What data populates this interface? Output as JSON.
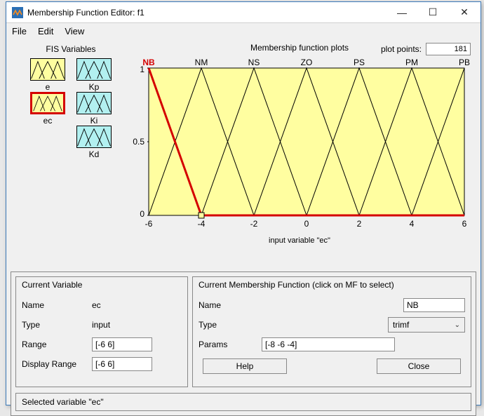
{
  "window": {
    "title": "Membership Function Editor: f1"
  },
  "menu": {
    "file": "File",
    "edit": "Edit",
    "view": "View"
  },
  "fis": {
    "header": "FIS Variables",
    "inputs": [
      {
        "name": "e"
      },
      {
        "name": "ec",
        "selected": true
      }
    ],
    "outputs": [
      {
        "name": "Kp"
      },
      {
        "name": "Ki"
      },
      {
        "name": "Kd"
      }
    ]
  },
  "plot": {
    "title": "Membership function plots",
    "plot_points_label": "plot points:",
    "plot_points": "181",
    "xlabel": "input variable \"ec\"",
    "xticks": [
      "-6",
      "-4",
      "-2",
      "0",
      "2",
      "4",
      "6"
    ],
    "yticks": [
      "0",
      "0.5",
      "1"
    ],
    "mf_labels": [
      "NB",
      "NM",
      "NS",
      "ZO",
      "PS",
      "PM",
      "PB"
    ],
    "selected_mf": "NB"
  },
  "chart_data": {
    "type": "line",
    "title": "Membership function plots",
    "xlabel": "input variable \"ec\"",
    "ylabel": "",
    "xlim": [
      -6,
      6
    ],
    "ylim": [
      0,
      1
    ],
    "series": [
      {
        "name": "NB",
        "x": [
          -8,
          -6,
          -4
        ],
        "y": [
          0,
          1,
          0
        ],
        "selected": true
      },
      {
        "name": "NM",
        "x": [
          -6,
          -4,
          -2
        ],
        "y": [
          0,
          1,
          0
        ]
      },
      {
        "name": "NS",
        "x": [
          -4,
          -2,
          0
        ],
        "y": [
          0,
          1,
          0
        ]
      },
      {
        "name": "ZO",
        "x": [
          -2,
          0,
          2
        ],
        "y": [
          0,
          1,
          0
        ]
      },
      {
        "name": "PS",
        "x": [
          0,
          2,
          4
        ],
        "y": [
          0,
          1,
          0
        ]
      },
      {
        "name": "PM",
        "x": [
          2,
          4,
          6
        ],
        "y": [
          0,
          1,
          0
        ]
      },
      {
        "name": "PB",
        "x": [
          4,
          6,
          8
        ],
        "y": [
          0,
          1,
          0
        ]
      }
    ]
  },
  "current_var": {
    "title": "Current Variable",
    "name_label": "Name",
    "name": "ec",
    "type_label": "Type",
    "type": "input",
    "range_label": "Range",
    "range": "[-6 6]",
    "disp_range_label": "Display Range",
    "disp_range": "[-6 6]"
  },
  "current_mf": {
    "title": "Current Membership Function (click on MF to select)",
    "name_label": "Name",
    "name": "NB",
    "type_label": "Type",
    "type": "trimf",
    "params_label": "Params",
    "params": "[-8 -6 -4]"
  },
  "buttons": {
    "help": "Help",
    "close": "Close"
  },
  "status": "Selected variable \"ec\""
}
